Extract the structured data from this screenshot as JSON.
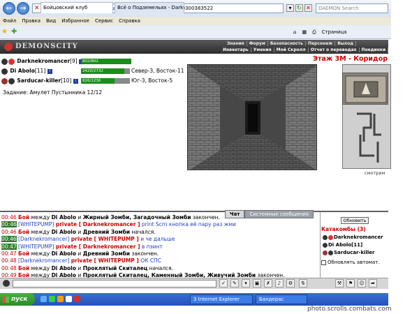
{
  "browser": {
    "url": "http://demonscity.combats.ru/buttons.pl?battle=0.899690300383522",
    "search_placeholder": "DAEMON Search",
    "menu": [
      "Файл",
      "Правка",
      "Вид",
      "Избранное",
      "Сервис",
      "Справка"
    ],
    "tabs": [
      {
        "label": "Бойцовский клуб"
      },
      {
        "label": "Всё о Подземельях - DarkCl..."
      }
    ],
    "tools": [
      "Страница"
    ]
  },
  "game": {
    "logo": "DEMONSCITY",
    "menu_top": [
      "Знания",
      "Форум",
      "Безопасность",
      "Персонаж",
      "Выход"
    ],
    "menu_bottom": [
      "Инвентарь",
      "Умения",
      "Мой Скролл",
      "Отчет о переводах",
      "Поединки"
    ],
    "location_title": "Этаж 3М - Коридор",
    "look_label": "смотрим",
    "quest": "Задание: Амулет Пустынника 12/12",
    "players": [
      {
        "name": "Darknekromancer",
        "level": "[9]",
        "hp": "802/802",
        "coords": ""
      },
      {
        "name": "Di Abolo",
        "level": "[11]",
        "hp": "2420/2732",
        "coords": "Север-3, Восток-11"
      },
      {
        "name": "Sarducar-killer",
        "level": "[10]",
        "hp": "826/1236",
        "coords": "Юг-3, Восток-5"
      }
    ]
  },
  "chat": {
    "tabs": [
      "Чат",
      "Системные сообщения"
    ],
    "lines": [
      {
        "time": "00:46",
        "parts": [
          [
            "red",
            "Бой"
          ],
          [
            "",
            " между "
          ],
          [
            "bold",
            "Di Abolo"
          ],
          [
            "",
            " и "
          ],
          [
            "bold",
            "Жирный Зомби, Загадочный Зомби"
          ],
          [
            "",
            " закончен."
          ]
        ]
      },
      {
        "time": "00:46",
        "hl": true,
        "parts": [
          [
            "blue",
            "[WHITEPUMP] "
          ],
          [
            "red",
            "private [ Darknekromancer ]"
          ],
          [
            "blue",
            " print Scrn кнопка её пару раз жми"
          ]
        ]
      },
      {
        "time": "00:46",
        "parts": [
          [
            "red",
            "Бой"
          ],
          [
            "",
            " между "
          ],
          [
            "bold",
            "Di Abolo"
          ],
          [
            "",
            " и "
          ],
          [
            "bold",
            "Древний Зомби"
          ],
          [
            "",
            " начался."
          ]
        ]
      },
      {
        "time": "00:46",
        "hl": true,
        "parts": [
          [
            "blue",
            "[Darknekromancer] "
          ],
          [
            "red",
            "private [ WHITEPUMP ]"
          ],
          [
            "blue",
            " и че дальше"
          ]
        ]
      },
      {
        "time": "00:47",
        "hl": true,
        "parts": [
          [
            "blue",
            "[WHITEPUMP] "
          ],
          [
            "red",
            "private [ Darknekromancer ]"
          ],
          [
            "blue",
            " в пэинт"
          ]
        ]
      },
      {
        "time": "00:47",
        "parts": [
          [
            "red",
            "Бой"
          ],
          [
            "",
            " между "
          ],
          [
            "bold",
            "Di Abolo"
          ],
          [
            "",
            " и "
          ],
          [
            "bold",
            "Древний Зомби"
          ],
          [
            "",
            " закончен."
          ]
        ]
      },
      {
        "time": "00:48",
        "parts": [
          [
            "blue",
            "[Darknekromancer] "
          ],
          [
            "red",
            "private [ WHITEPUMP ]"
          ],
          [
            "blue",
            " ОК СПС"
          ]
        ]
      },
      {
        "time": "00:48",
        "parts": [
          [
            "red",
            "Бой"
          ],
          [
            "",
            " между "
          ],
          [
            "bold",
            "Di Abolo"
          ],
          [
            "",
            " и "
          ],
          [
            "bold",
            "Проклятый Скиталец"
          ],
          [
            "",
            " начался."
          ]
        ]
      },
      {
        "time": "00:49",
        "parts": [
          [
            "red",
            "Бой"
          ],
          [
            "",
            " между "
          ],
          [
            "bold",
            "Di Abolo"
          ],
          [
            "",
            " и "
          ],
          [
            "bold",
            "Проклятый Скиталец, Каменный Зомби, Живучий Зомби"
          ],
          [
            "",
            " закончен."
          ]
        ]
      }
    ]
  },
  "room": {
    "refresh_label": "Обновить",
    "title": "Катакомбы (3)",
    "members": [
      "Darknekromancer",
      "Di Abolo[11]",
      "Sarducar-killer"
    ],
    "autorefresh_label": "Обновлять автомат."
  },
  "taskbar": {
    "start_label": "пуск",
    "tasks": [
      "3 Internet Explorer",
      "Бандерас"
    ],
    "watermark": "photo.scrolls.combats.com"
  },
  "colors": {
    "accent_red": "#cc0000",
    "hp_green": "#1a8d1a",
    "private_blue": "#1e3fc8"
  }
}
